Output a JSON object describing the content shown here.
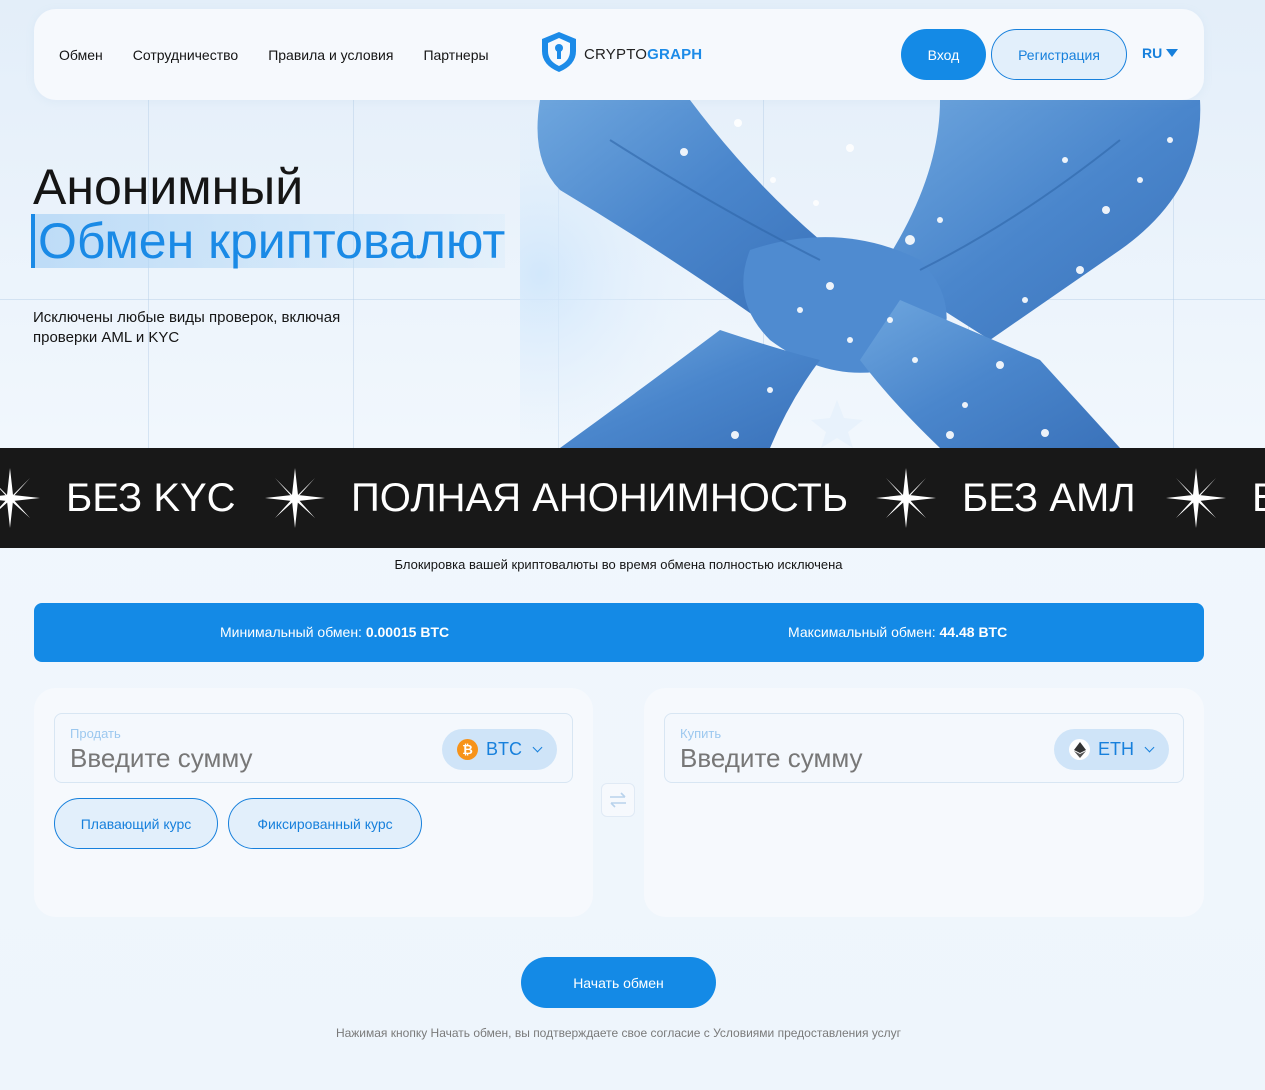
{
  "header": {
    "nav": [
      "Обмен",
      "Сотрудничество",
      "Правила и условия",
      "Партнеры"
    ],
    "logo": {
      "part1": "CRYPTO",
      "part2": "GRAPH",
      "icon": "shield-keyhole-icon"
    },
    "login_label": "Вход",
    "register_label": "Регистрация",
    "lang": "RU"
  },
  "hero": {
    "title": "Анонимный",
    "subtitle": "Обмен криптовалют",
    "description": "Исключены любые виды проверок, включая проверки AML и KYC"
  },
  "ticker": {
    "items": [
      "БЕЗ KYC",
      "ПОЛНАЯ АНОНИМНОСТЬ",
      "БЕЗ АМЛ",
      "Б"
    ],
    "separator_icon": "sparkle-star-icon"
  },
  "lock_note": "Блокировка вашей криптовалюты во время обмена полностью исключена",
  "limits": {
    "min_label": "Минимальный обмен:",
    "min_value": "0.00015 BTC",
    "max_label": "Максимальный обмен:",
    "max_value": "44.48 BTC"
  },
  "sell": {
    "label": "Продать",
    "placeholder": "Введите сумму",
    "currency": "BTC",
    "currency_icon": "bitcoin-icon",
    "rate_floating": "Плавающий курс",
    "rate_fixed": "Фиксированный курс"
  },
  "buy": {
    "label": "Купить",
    "placeholder": "Введите сумму",
    "currency": "ETH",
    "currency_icon": "ethereum-icon"
  },
  "swap_icon": "swap-arrows-icon",
  "start_label": "Начать обмен",
  "consent": "Нажимая кнопку Начать обмен, вы подтверждаете свое согласие с Условиями предоставления услуг",
  "colors": {
    "accent": "#148ae6",
    "ticker_bg": "#181818",
    "page_bg": "#eef5fc"
  }
}
